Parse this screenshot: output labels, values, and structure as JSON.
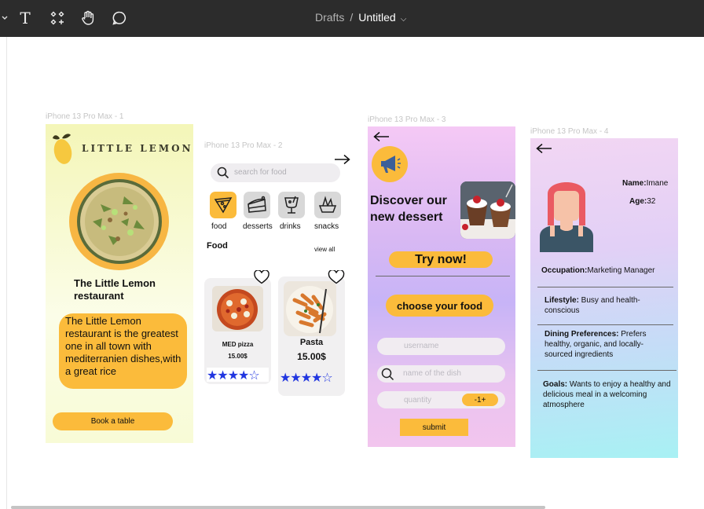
{
  "toolbar": {
    "breadcrumb_parent": "Drafts",
    "breadcrumb_sep": "/",
    "file_name": "Untitled",
    "tools": [
      "move-tool",
      "text-tool",
      "components-tool",
      "hand-tool",
      "comment-tool"
    ],
    "text_glyph": "T"
  },
  "frames": {
    "f1_label": "iPhone 13 Pro Max - 1",
    "f2_label": "iPhone 13 Pro Max - 2",
    "f3_label": "iPhone 13 Pro Max - 3",
    "f4_label": "iPhone 13 Pro Max - 4"
  },
  "screen1": {
    "brand": "LITTLE LEMON",
    "title": "The Little Lemon restaurant",
    "description": "The Little Lemon restaurant is the greatest one in all town with mediterranien dishes,with a great rice",
    "cta": "Book a table"
  },
  "screen2": {
    "search_placeholder": "search for food",
    "categories": [
      "food",
      "desserts",
      "drinks",
      "snacks"
    ],
    "section_title": "Food",
    "view_all": "view all",
    "items": [
      {
        "name": "MED pizza",
        "price": "15.00$",
        "rating": 4
      },
      {
        "name": "Pasta",
        "price": "15.00$",
        "rating": 4
      }
    ]
  },
  "screen3": {
    "headline": "Discover our new dessert",
    "try_now": "Try now!",
    "choose": "choose your food",
    "username_placeholder": "username",
    "dish_placeholder": "name of the dish",
    "quantity_label": "quantity",
    "quantity_stepper": "-1+",
    "submit": "submit"
  },
  "screen4": {
    "name_label": "Name:",
    "name_value": "Imane",
    "age_label": "Age:",
    "age_value": "32",
    "occupation_label": "Occupation:",
    "occupation_value": "Marketing Manager",
    "lifestyle_label": "Lifestyle:",
    "lifestyle_value": " Busy and health-conscious",
    "dining_label": "Dining Preferences:",
    "dining_value": " Prefers healthy, organic, and locally-sourced ingredients",
    "goals_label": "Goals:",
    "goals_value": " Wants to enjoy a healthy and delicious meal in a welcoming atmosphere"
  },
  "colors": {
    "accent_yellow": "#fbbb3b",
    "star_blue": "#2136e0",
    "toolbar_bg": "#2c2c2c"
  }
}
